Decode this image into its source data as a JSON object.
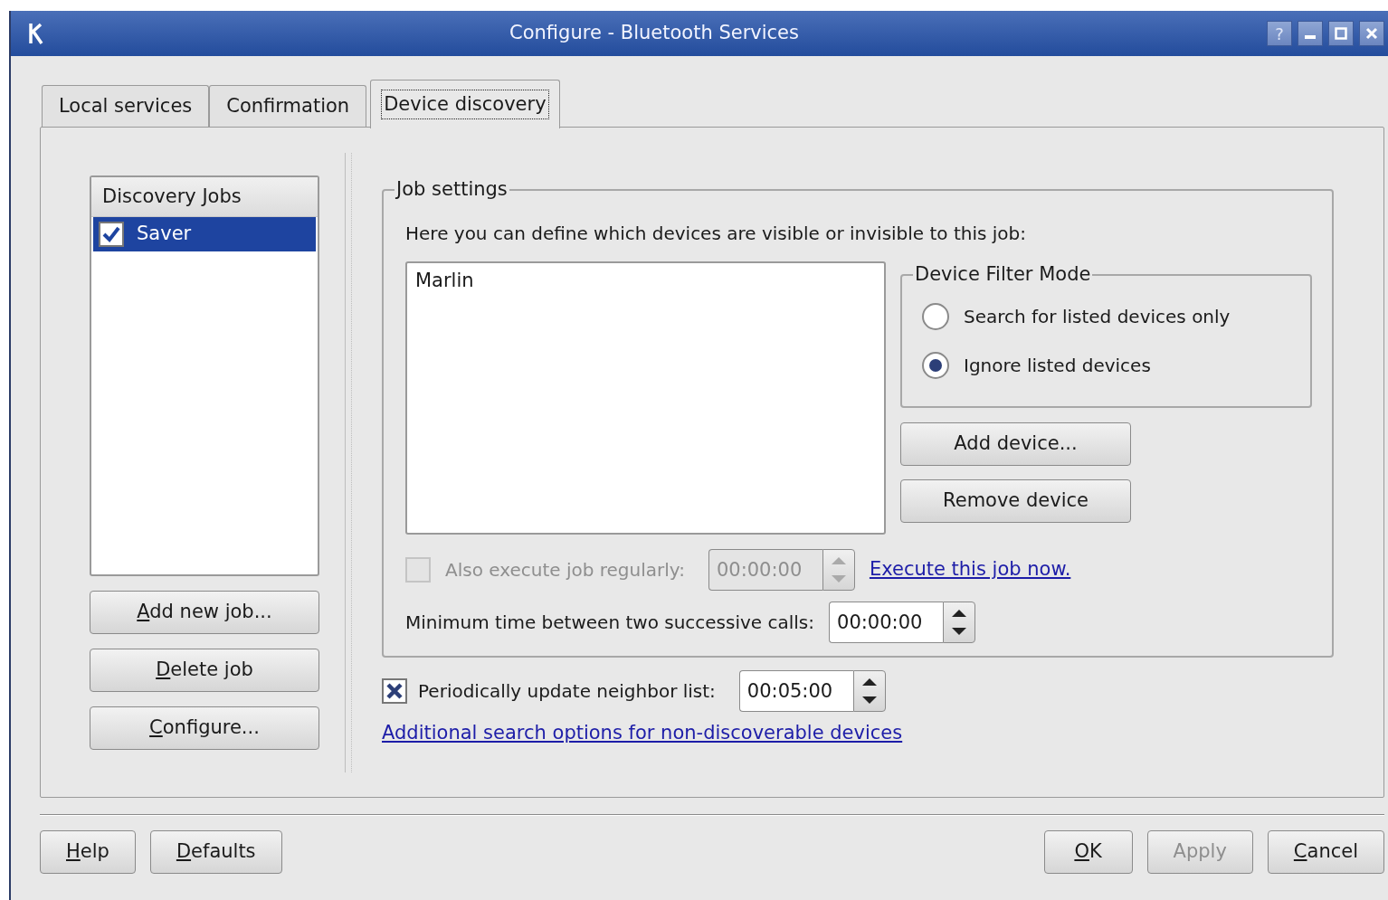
{
  "window": {
    "title": "Configure - Bluetooth Services",
    "help_button": "?"
  },
  "tabs": [
    {
      "label": "Local services",
      "selected": false
    },
    {
      "label": "Confirmation",
      "selected": false
    },
    {
      "label": "Device discovery",
      "selected": true
    }
  ],
  "jobs_list": {
    "header": "Discovery Jobs",
    "items": [
      {
        "label": "Saver",
        "checked": true,
        "selected": true
      }
    ]
  },
  "job_buttons": [
    {
      "label": "Add new job...",
      "mnemonic": true
    },
    {
      "label": "Delete job",
      "mnemonic": true
    },
    {
      "label": "Configure...",
      "mnemonic": true
    }
  ],
  "job_settings": {
    "title": "Job settings",
    "description": "Here you can define which devices are visible or invisible to this job:",
    "devices": [
      "Marlin"
    ],
    "filter_mode": {
      "title": "Device Filter Mode",
      "options": [
        {
          "label": "Search for listed devices only",
          "selected": false
        },
        {
          "label": "Ignore listed devices",
          "selected": true
        }
      ]
    },
    "device_buttons": [
      {
        "label": "Add device..."
      },
      {
        "label": "Remove device"
      }
    ],
    "regular": {
      "label": "Also execute job regularly:",
      "checked": false,
      "disabled": true,
      "value": "00:00:00"
    },
    "execute_link": "Execute this job now.",
    "min_time": {
      "label": "Minimum time between two successive calls:",
      "value": "00:00:00"
    }
  },
  "periodic": {
    "label": "Periodically update neighbor list:",
    "checked": true,
    "value": "00:05:00"
  },
  "additional_link": "Additional search options for non-discoverable devices",
  "footer_left_buttons": [
    {
      "label": "Help",
      "mnemonic": true,
      "disabled": false
    },
    {
      "label": "Defaults",
      "mnemonic": true,
      "disabled": false
    }
  ],
  "footer_right_buttons": [
    {
      "label": "OK",
      "mnemonic": true,
      "disabled": false
    },
    {
      "label": "Apply",
      "mnemonic": false,
      "disabled": true
    },
    {
      "label": "Cancel",
      "mnemonic": true,
      "disabled": false
    }
  ]
}
